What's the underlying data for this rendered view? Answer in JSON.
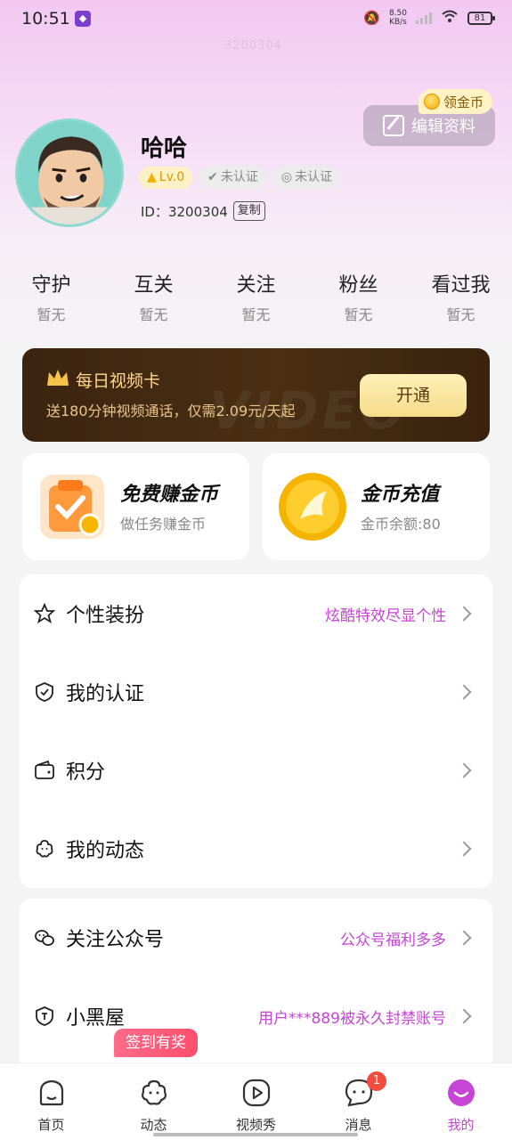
{
  "status_bar": {
    "time": "10:51",
    "net_speed": "8.50",
    "net_unit": "KB/s",
    "battery": "81"
  },
  "watermark": "3200304",
  "profile": {
    "name": "哈哈",
    "level_badge": "Lv.0",
    "verify_badge_1": "未认证",
    "verify_badge_2": "未认证",
    "id_label": "ID：3200304",
    "copy_label": "复制",
    "edit_label": "编辑资料",
    "coin_tip": "领金币"
  },
  "stats": [
    {
      "label": "守护",
      "value": "暂无"
    },
    {
      "label": "互关",
      "value": "暂无"
    },
    {
      "label": "关注",
      "value": "暂无"
    },
    {
      "label": "粉丝",
      "value": "暂无"
    },
    {
      "label": "看过我",
      "value": "暂无"
    }
  ],
  "vip_card": {
    "title": "每日视频卡",
    "subtitle": "送180分钟视频通话，仅需2.09元/天起",
    "button": "开通",
    "bg_text": "VIDEO"
  },
  "coin_cards": {
    "earn": {
      "title": "免费赚金币",
      "subtitle": "做任务赚金币"
    },
    "recharge": {
      "title": "金币充值",
      "subtitle": "金币余额:80"
    }
  },
  "menu_a": [
    {
      "label": "个性装扮",
      "hint": "炫酷特效尽显个性",
      "icon": "star-icon"
    },
    {
      "label": "我的认证",
      "hint": "",
      "icon": "shield-check-icon"
    },
    {
      "label": "积分",
      "hint": "",
      "icon": "wallet-icon"
    },
    {
      "label": "我的动态",
      "hint": "",
      "icon": "flower-icon"
    }
  ],
  "menu_b": [
    {
      "label": "关注公众号",
      "hint": "公众号福利多多",
      "icon": "wechat-icon"
    },
    {
      "label": "小黑屋",
      "hint": "用户***889被永久封禁账号",
      "icon": "shield-ban-icon"
    }
  ],
  "checkin_tag": "签到有奖",
  "tabs": [
    {
      "label": "首页",
      "icon": "home-icon"
    },
    {
      "label": "动态",
      "icon": "moments-icon"
    },
    {
      "label": "视频秀",
      "icon": "video-play-icon"
    },
    {
      "label": "消息",
      "icon": "message-icon",
      "badge": "1"
    },
    {
      "label": "我的",
      "icon": "profile-icon"
    }
  ],
  "colors": {
    "accent": "#c644d6",
    "vip_bg": "#3d2410",
    "badge_red": "#f24c3d"
  }
}
